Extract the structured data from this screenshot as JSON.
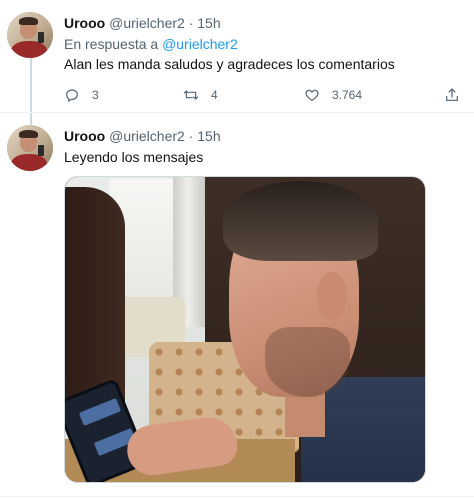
{
  "tweets": [
    {
      "name": "Urooo",
      "handle": "@urielcher2",
      "dot": "·",
      "time": "15h",
      "reply_prefix": "En respuesta a",
      "reply_mention": "@urielcher2",
      "text": "Alan les manda saludos y agradeces los comentarios",
      "actions": {
        "reply_count": "3",
        "retweet_count": "4",
        "like_count": "3.764"
      }
    },
    {
      "name": "Urooo",
      "handle": "@urielcher2",
      "dot": "·",
      "time": "15h",
      "text": "Leyendo los mensajes"
    }
  ],
  "icons": {
    "reply": "reply-icon",
    "retweet": "retweet-icon",
    "like": "heart-icon",
    "share": "share-icon"
  },
  "colors": {
    "primary_text": "#0f1419",
    "secondary_text": "#536471",
    "mention": "#1d9bf0",
    "divider": "#eff3f4"
  }
}
